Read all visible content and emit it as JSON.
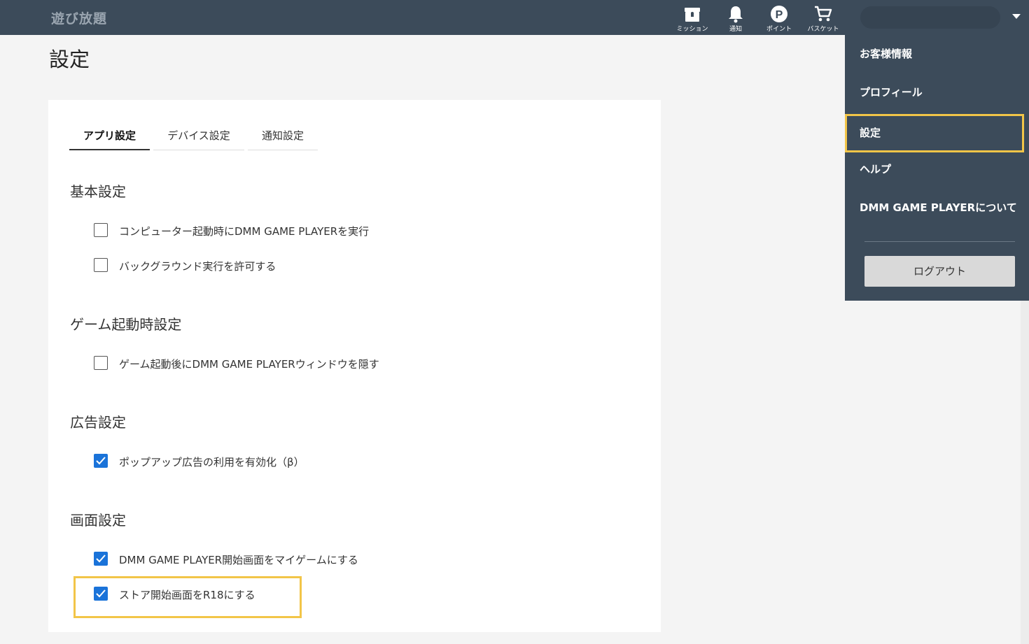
{
  "header": {
    "logo": "遊び放題",
    "icons": [
      {
        "name": "mission-icon",
        "label": "ミッション"
      },
      {
        "name": "bell-icon",
        "label": "通知"
      },
      {
        "name": "point-icon",
        "label": "ポイント"
      },
      {
        "name": "cart-icon",
        "label": "バスケット"
      }
    ]
  },
  "page": {
    "title": "設定"
  },
  "tabs": [
    {
      "label": "アプリ設定",
      "active": true
    },
    {
      "label": "デバイス設定",
      "active": false
    },
    {
      "label": "通知設定",
      "active": false
    }
  ],
  "sections": {
    "basic": {
      "title": "基本設定",
      "options": [
        {
          "label": "コンピューター起動時にDMM GAME PLAYERを実行",
          "checked": false
        },
        {
          "label": "バックグラウンド実行を許可する",
          "checked": false
        }
      ]
    },
    "game_launch": {
      "title": "ゲーム起動時設定",
      "options": [
        {
          "label": "ゲーム起動後にDMM GAME PLAYERウィンドウを隠す",
          "checked": false
        }
      ]
    },
    "ads": {
      "title": "広告設定",
      "options": [
        {
          "label": "ポップアップ広告の利用を有効化（β）",
          "checked": true
        }
      ]
    },
    "screen": {
      "title": "画面設定",
      "options": [
        {
          "label": "DMM GAME PLAYER開始画面をマイゲームにする",
          "checked": true
        },
        {
          "label": "ストア開始画面をR18にする",
          "checked": true
        }
      ]
    }
  },
  "menu": {
    "items": [
      "お客様情報",
      "プロフィール",
      "設定",
      "ヘルプ",
      "DMM GAME PLAYERについて"
    ],
    "selected": "設定",
    "logout": "ログアウト"
  },
  "colors": {
    "header_bg": "#3c4b5a",
    "checkbox_on": "#1a73d9",
    "highlight": "#f2c548"
  }
}
